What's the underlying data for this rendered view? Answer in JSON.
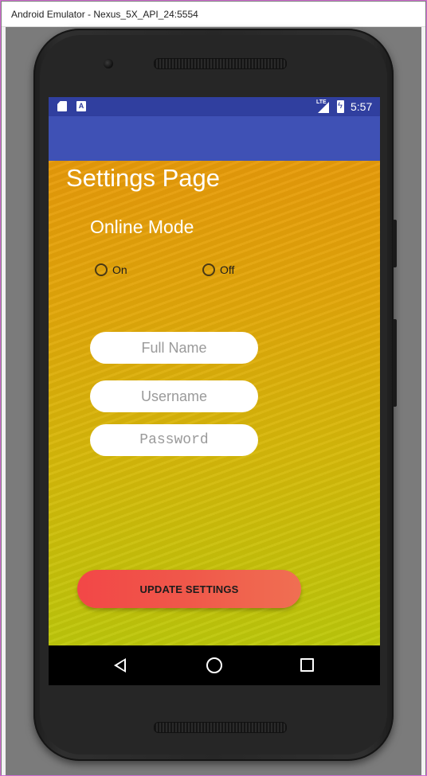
{
  "window": {
    "title": "Android Emulator - Nexus_5X_API_24:5554"
  },
  "statusbar": {
    "time": "5:57",
    "network": "LTE",
    "a_icon": "A",
    "icons": [
      "sd-card-icon",
      "a-notification-icon",
      "signal-icon",
      "battery-charging-icon"
    ]
  },
  "page": {
    "title": "Settings Page",
    "section_title": "Online Mode",
    "radio_on_label": "On",
    "radio_off_label": "Off"
  },
  "form": {
    "full_name_placeholder": "Full Name",
    "username_placeholder": "Username",
    "password_placeholder": "Password"
  },
  "actions": {
    "update_label": "UPDATE SETTINGS"
  },
  "navbar": {
    "icons": [
      "back-icon",
      "home-icon",
      "recent-apps-icon"
    ]
  },
  "colors": {
    "statusbar": "#303f9f",
    "actionbar": "#3f51b5",
    "gradient_top": "#e79a0a",
    "gradient_bottom": "#bcc80b",
    "button_start": "#f24747",
    "button_end": "#f06f52"
  }
}
